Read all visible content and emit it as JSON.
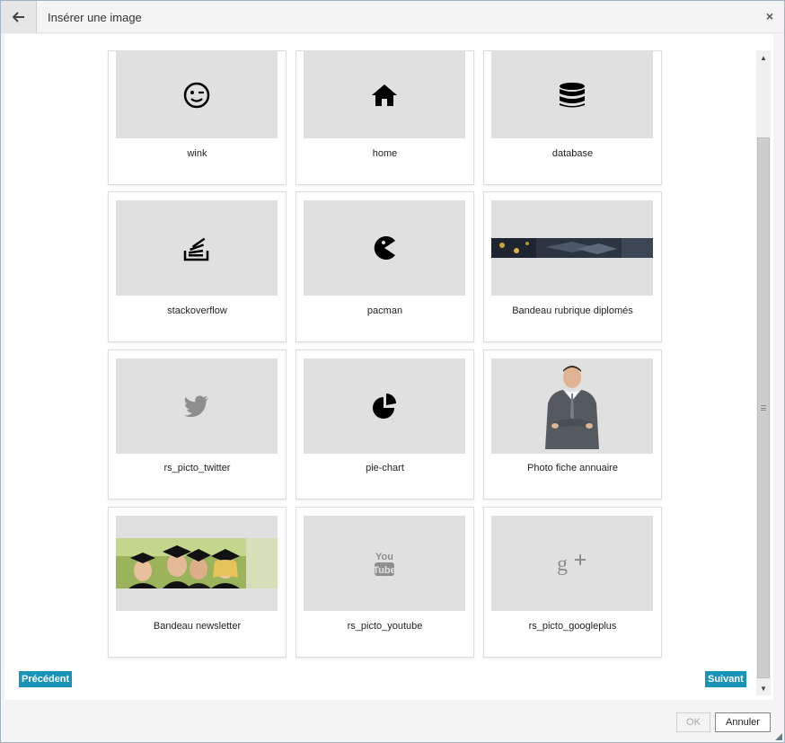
{
  "dialog": {
    "title": "Insérer une image",
    "close_label": "×"
  },
  "grid": {
    "cards": [
      {
        "label": "wink",
        "icon": "wink-icon"
      },
      {
        "label": "home",
        "icon": "home-icon"
      },
      {
        "label": "database",
        "icon": "database-icon"
      },
      {
        "label": "stackoverflow",
        "icon": "stackoverflow-icon"
      },
      {
        "label": "pacman",
        "icon": "pacman-icon"
      },
      {
        "label": "Bandeau rubrique diplomés",
        "icon": "graduation-banner-image"
      },
      {
        "label": "rs_picto_twitter",
        "icon": "twitter-icon"
      },
      {
        "label": "pie-chart",
        "icon": "pie-chart-icon"
      },
      {
        "label": "Photo fiche annuaire",
        "icon": "businessman-photo"
      },
      {
        "label": "Bandeau newsletter",
        "icon": "graduates-banner-image"
      },
      {
        "label": "rs_picto_youtube",
        "icon": "youtube-icon"
      },
      {
        "label": "rs_picto_googleplus",
        "icon": "googleplus-icon"
      }
    ]
  },
  "pagination": {
    "previous_label": "Précédent",
    "next_label": "Suivant"
  },
  "footer": {
    "ok_label": "OK",
    "cancel_label": "Annuler"
  },
  "colors": {
    "accent": "#1a93b8",
    "thumb_bg": "#e0e0e0"
  }
}
